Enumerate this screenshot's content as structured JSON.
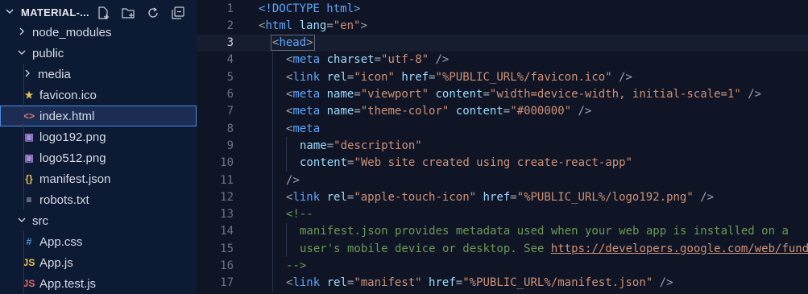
{
  "explorer": {
    "title": "MATERIAL-...",
    "actions": [
      {
        "name": "new-file-icon"
      },
      {
        "name": "new-folder-icon"
      },
      {
        "name": "refresh-icon"
      },
      {
        "name": "collapse-all-icon"
      }
    ],
    "items": [
      {
        "label": "node_modules",
        "depth": 1,
        "kind": "folder",
        "expanded": false
      },
      {
        "label": "public",
        "depth": 1,
        "kind": "folder",
        "expanded": true
      },
      {
        "label": "media",
        "depth": 2,
        "kind": "folder",
        "expanded": false
      },
      {
        "label": "favicon.ico",
        "depth": 2,
        "kind": "file",
        "icon": "★",
        "icon_color": "#e8c547"
      },
      {
        "label": "index.html",
        "depth": 2,
        "kind": "file",
        "icon": "<>",
        "icon_color": "#e37b6f",
        "selected": true
      },
      {
        "label": "logo192.png",
        "depth": 2,
        "kind": "file",
        "icon": "▣",
        "icon_color": "#a48ad6"
      },
      {
        "label": "logo512.png",
        "depth": 2,
        "kind": "file",
        "icon": "▣",
        "icon_color": "#a48ad6"
      },
      {
        "label": "manifest.json",
        "depth": 2,
        "kind": "file",
        "icon": "{}",
        "icon_color": "#e8c547"
      },
      {
        "label": "robots.txt",
        "depth": 2,
        "kind": "file",
        "icon": "≡",
        "icon_color": "#c9ced8"
      },
      {
        "label": "src",
        "depth": 1,
        "kind": "folder",
        "expanded": true
      },
      {
        "label": "App.css",
        "depth": 2,
        "kind": "file",
        "icon": "#",
        "icon_color": "#4f9fd9"
      },
      {
        "label": "App.js",
        "depth": 2,
        "kind": "file",
        "icon": "JS",
        "icon_color": "#e8c547"
      },
      {
        "label": "App.test.js",
        "depth": 2,
        "kind": "file",
        "icon": "JS",
        "icon_color": "#e06c5a"
      }
    ]
  },
  "editor": {
    "current_line": 3,
    "lines": [
      {
        "n": "1",
        "indent": 0,
        "tokens": [
          [
            "doctype",
            "<!DOCTYPE "
          ],
          [
            "tag",
            "html"
          ],
          [
            "doctype",
            ">"
          ]
        ]
      },
      {
        "n": "2",
        "indent": 0,
        "tokens": [
          [
            "punct",
            "<"
          ],
          [
            "tag",
            "html "
          ],
          [
            "attr",
            "lang"
          ],
          [
            "punct",
            "="
          ],
          [
            "str",
            "\"en\""
          ],
          [
            "punct",
            ">"
          ]
        ]
      },
      {
        "n": "3",
        "indent": 1,
        "tokens": [
          [
            "punct",
            "<"
          ],
          [
            "tag",
            "head"
          ],
          [
            "punct",
            ">"
          ]
        ]
      },
      {
        "n": "4",
        "indent": 2,
        "tokens": [
          [
            "punct",
            "<"
          ],
          [
            "tag",
            "meta "
          ],
          [
            "attr",
            "charset"
          ],
          [
            "punct",
            "="
          ],
          [
            "str",
            "\"utf-8\""
          ],
          [
            "punct",
            " />"
          ]
        ]
      },
      {
        "n": "5",
        "indent": 2,
        "tokens": [
          [
            "punct",
            "<"
          ],
          [
            "tag",
            "link "
          ],
          [
            "attr",
            "rel"
          ],
          [
            "punct",
            "="
          ],
          [
            "str",
            "\"icon\" "
          ],
          [
            "attr",
            "href"
          ],
          [
            "punct",
            "="
          ],
          [
            "str",
            "\"%PUBLIC_URL%/favicon.ico\""
          ],
          [
            "punct",
            " />"
          ]
        ]
      },
      {
        "n": "6",
        "indent": 2,
        "tokens": [
          [
            "punct",
            "<"
          ],
          [
            "tag",
            "meta "
          ],
          [
            "attr",
            "name"
          ],
          [
            "punct",
            "="
          ],
          [
            "str",
            "\"viewport\" "
          ],
          [
            "attr",
            "content"
          ],
          [
            "punct",
            "="
          ],
          [
            "str",
            "\"width=device-width, initial-scale=1\""
          ],
          [
            "punct",
            " />"
          ]
        ]
      },
      {
        "n": "7",
        "indent": 2,
        "tokens": [
          [
            "punct",
            "<"
          ],
          [
            "tag",
            "meta "
          ],
          [
            "attr",
            "name"
          ],
          [
            "punct",
            "="
          ],
          [
            "str",
            "\"theme-color\" "
          ],
          [
            "attr",
            "content"
          ],
          [
            "punct",
            "="
          ],
          [
            "str",
            "\"#000000\""
          ],
          [
            "punct",
            " />"
          ]
        ]
      },
      {
        "n": "8",
        "indent": 2,
        "tokens": [
          [
            "punct",
            "<"
          ],
          [
            "tag",
            "meta"
          ]
        ]
      },
      {
        "n": "9",
        "indent": 3,
        "tokens": [
          [
            "attr",
            "name"
          ],
          [
            "punct",
            "="
          ],
          [
            "str",
            "\"description\""
          ]
        ]
      },
      {
        "n": "10",
        "indent": 3,
        "tokens": [
          [
            "attr",
            "content"
          ],
          [
            "punct",
            "="
          ],
          [
            "str",
            "\"Web site created using create-react-app\""
          ]
        ]
      },
      {
        "n": "11",
        "indent": 2,
        "tokens": [
          [
            "punct",
            "/>"
          ]
        ]
      },
      {
        "n": "12",
        "indent": 2,
        "tokens": [
          [
            "punct",
            "<"
          ],
          [
            "tag",
            "link "
          ],
          [
            "attr",
            "rel"
          ],
          [
            "punct",
            "="
          ],
          [
            "str",
            "\"apple-touch-icon\" "
          ],
          [
            "attr",
            "href"
          ],
          [
            "punct",
            "="
          ],
          [
            "str",
            "\"%PUBLIC_URL%/logo192.png\""
          ],
          [
            "punct",
            " />"
          ]
        ]
      },
      {
        "n": "13",
        "indent": 2,
        "tokens": [
          [
            "cmt",
            "<!--"
          ]
        ]
      },
      {
        "n": "14",
        "indent": 3,
        "tokens": [
          [
            "cmt",
            "manifest.json provides metadata used when your web app is installed on a"
          ]
        ]
      },
      {
        "n": "15",
        "indent": 3,
        "tokens": [
          [
            "cmt",
            "user's mobile device or desktop. See "
          ],
          [
            "link",
            "https://developers.google.com/web/fund"
          ]
        ]
      },
      {
        "n": "16",
        "indent": 2,
        "tokens": [
          [
            "cmt",
            "-->"
          ]
        ]
      },
      {
        "n": "17",
        "indent": 2,
        "tokens": [
          [
            "punct",
            "<"
          ],
          [
            "tag",
            "link "
          ],
          [
            "attr",
            "rel"
          ],
          [
            "punct",
            "="
          ],
          [
            "str",
            "\"manifest\" "
          ],
          [
            "attr",
            "href"
          ],
          [
            "punct",
            "="
          ],
          [
            "str",
            "\"%PUBLIC_URL%/manifest.json\""
          ],
          [
            "punct",
            " />"
          ]
        ]
      }
    ]
  }
}
